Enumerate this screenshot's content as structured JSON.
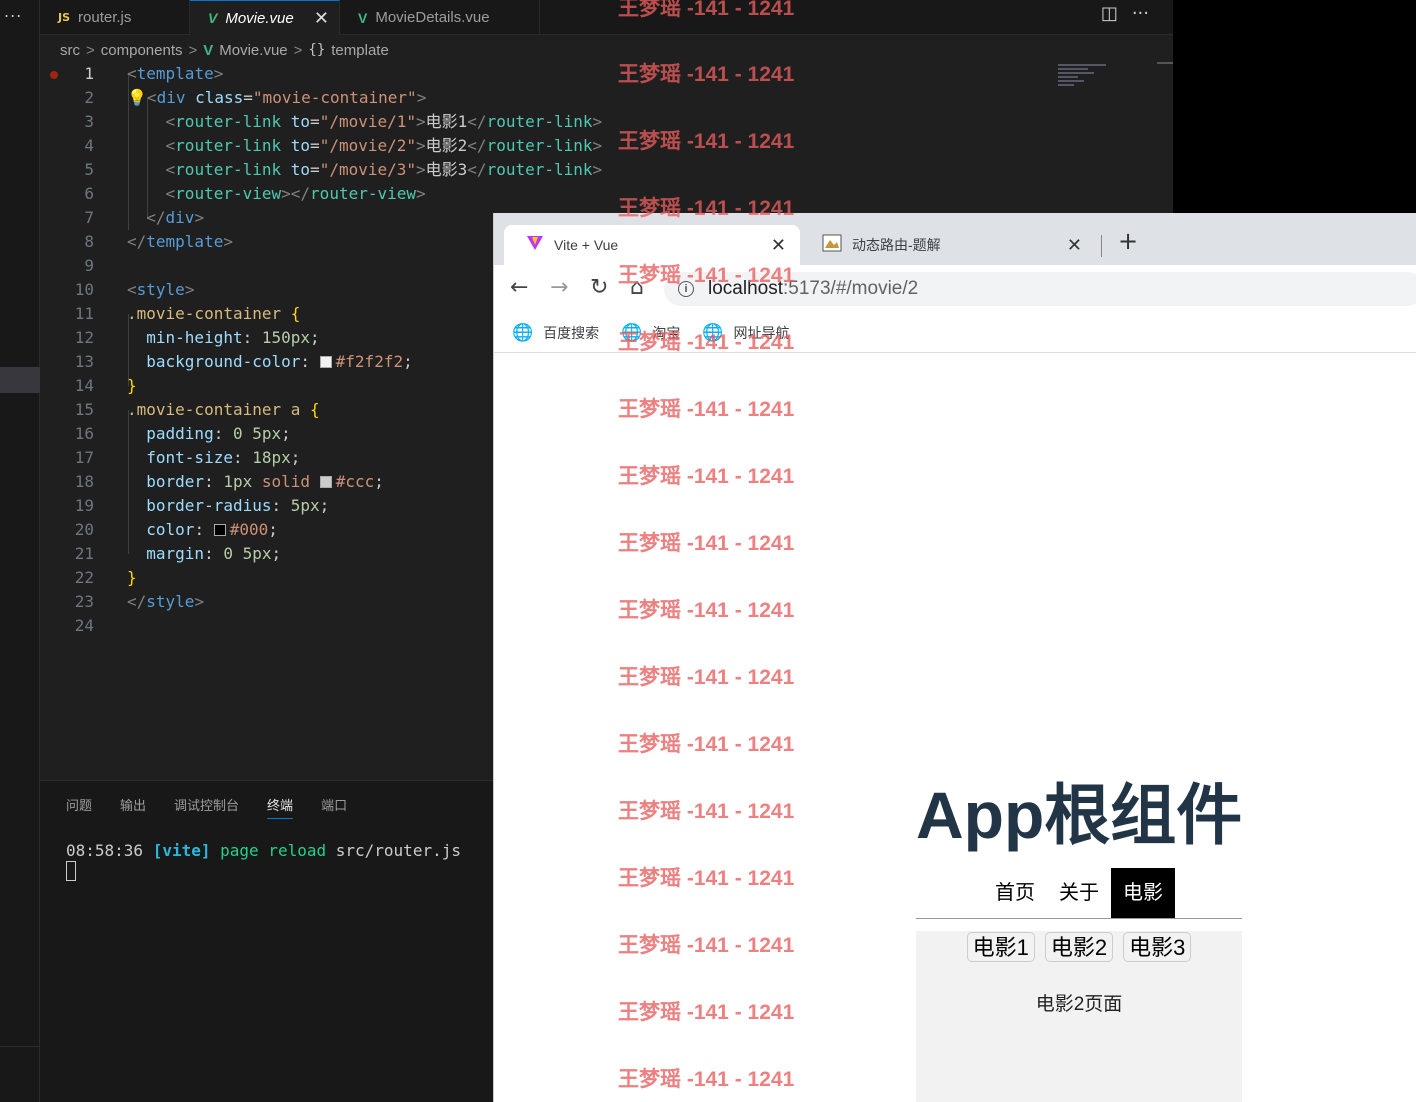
{
  "vscode": {
    "activity_dots": "...",
    "tabs": [
      {
        "icon": "JS",
        "label": "router.js"
      },
      {
        "icon": "V",
        "label": "Movie.vue",
        "close": "✕"
      },
      {
        "icon": "V",
        "label": "MovieDetails.vue"
      }
    ],
    "tab_actions": {
      "split": "◫",
      "more": "···"
    },
    "breadcrumb": {
      "src": "src",
      "components": "components",
      "file": "Movie.vue",
      "symbol_icon": "{}",
      "symbol": "template",
      "sep": ">"
    },
    "code_lines": [
      {
        "n": "1"
      },
      {
        "n": "2"
      },
      {
        "n": "3"
      },
      {
        "n": "4"
      },
      {
        "n": "5"
      },
      {
        "n": "6"
      },
      {
        "n": "7"
      },
      {
        "n": "8"
      },
      {
        "n": "9"
      },
      {
        "n": "10"
      },
      {
        "n": "11"
      },
      {
        "n": "12"
      },
      {
        "n": "13"
      },
      {
        "n": "14"
      },
      {
        "n": "15"
      },
      {
        "n": "16"
      },
      {
        "n": "17"
      },
      {
        "n": "18"
      },
      {
        "n": "19"
      },
      {
        "n": "20"
      },
      {
        "n": "21"
      },
      {
        "n": "22"
      },
      {
        "n": "23"
      },
      {
        "n": "24"
      }
    ],
    "panel": {
      "tabs": [
        "问题",
        "输出",
        "调试控制台",
        "终端",
        "端口"
      ],
      "active_tab": "终端",
      "terminal": {
        "time": "08:58:36",
        "tag": "[vite]",
        "msg": "page reload",
        "file": "src/router.js"
      }
    },
    "colors": {
      "keyword": "#569cd6",
      "tag": "#4ec9b0",
      "attr": "#9cdcfe",
      "string": "#ce9178"
    }
  },
  "browser": {
    "tabs": [
      {
        "icon": "vite-logo-icon",
        "title": "Vite + Vue",
        "close": "✕"
      },
      {
        "icon": "page-favicon-icon",
        "title": "动态路由-题解",
        "close": "✕"
      }
    ],
    "new_tab": "+",
    "nav": {
      "back": "←",
      "forward": "→",
      "reload": "↻",
      "home": "⌂"
    },
    "url": {
      "info": "i",
      "host": "localhost",
      "path": ":5173/#/movie/2"
    },
    "bookmarks": [
      "百度搜索",
      "淘宝",
      "网址导航"
    ],
    "page": {
      "app_title": "App根组件",
      "main_nav": [
        "首页",
        "关于",
        "电影"
      ],
      "active_nav": "电影",
      "movie_links": [
        "电影1",
        "电影2",
        "电影3"
      ],
      "movie_text": "电影2页面"
    }
  },
  "watermark": "王梦瑶 -141 - 1241"
}
